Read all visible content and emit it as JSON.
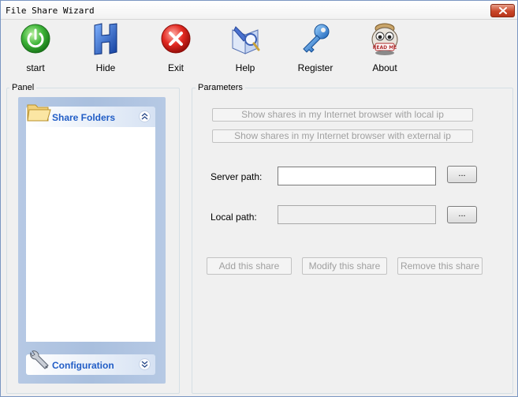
{
  "window": {
    "title": "File Share Wizard"
  },
  "toolbar": {
    "start": "start",
    "hide": "Hide",
    "exit": "Exit",
    "help": "Help",
    "register": "Register",
    "about": "About",
    "about_badge": "READ ME"
  },
  "panel": {
    "label": "Panel",
    "share_folders": "Share Folders",
    "configuration": "Configuration"
  },
  "parameters": {
    "label": "Parameters",
    "show_local": "Show shares in my Internet browser with local ip",
    "show_external": "Show shares in my Internet browser with external ip",
    "server_path_label": "Server path:",
    "server_path_value": "",
    "local_path_label": "Local path:",
    "local_path_value": "",
    "browse_label": "...",
    "add_share": "Add this share",
    "modify_share": "Modify this share",
    "remove_share": "Remove this share"
  },
  "colors": {
    "accent_text": "#215dc6",
    "nav_background": "#b6c9e4",
    "disabled_text": "#a0a0a0",
    "start_icon": "#2fa82f",
    "exit_icon": "#d9201d",
    "hide_icon": "#1f5fc8",
    "register_icon": "#2b7fd6"
  }
}
